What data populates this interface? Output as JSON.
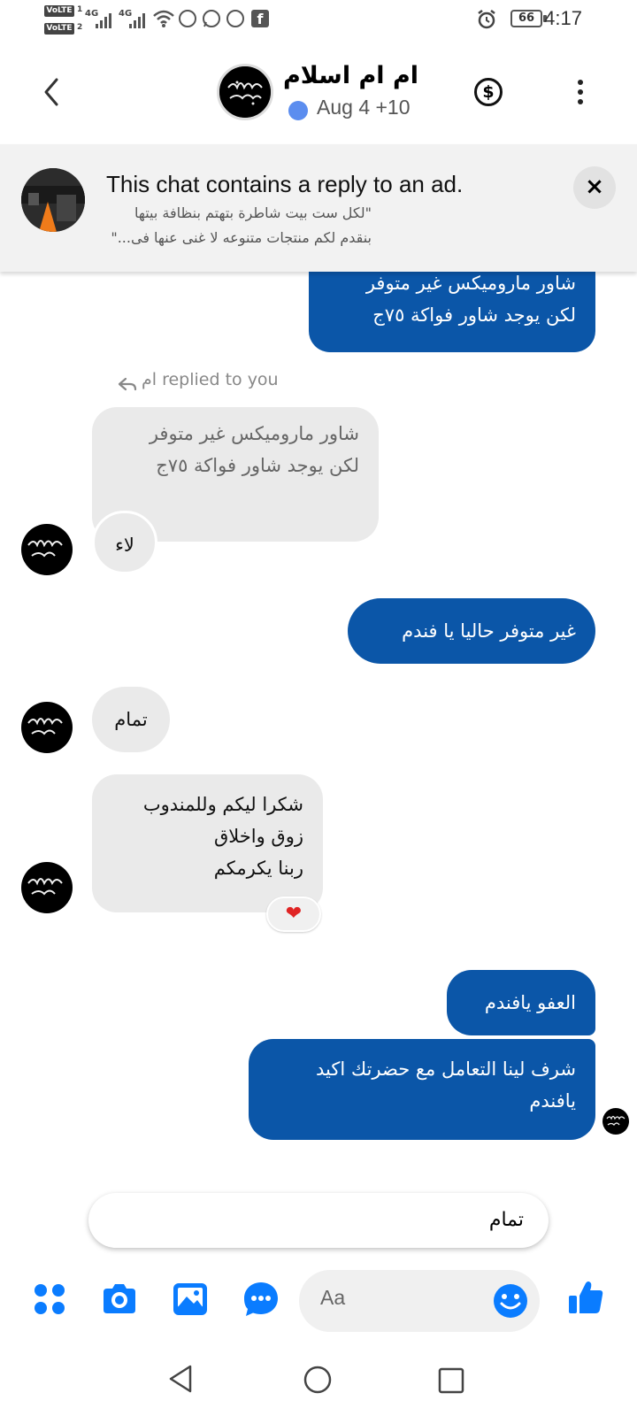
{
  "status_bar": {
    "volte1": "VoLTE",
    "sim1": "1",
    "volte2": "VoLTE",
    "sim2": "2",
    "net1": "4G",
    "net2": "4G",
    "battery": "66",
    "time": "4:17"
  },
  "header": {
    "name": "ام ام اسلام",
    "status": "Aug 4 +10",
    "status_dot_color": "#5b8def",
    "icons": [
      "back-arrow-icon",
      "dollar-icon",
      "more-vertical-icon"
    ]
  },
  "ad_banner": {
    "title": "This chat contains a reply to an ad.",
    "snippet_line1": "\"لكل ست بيت شاطرة بتهتم بنظافة بيتها",
    "snippet_line2": "بنقدم لكم منتجات متنوعه لا غنى عنها فى...\"",
    "close": "×"
  },
  "messages": {
    "m0_line1": "شاور ماروميكس غير متوفر",
    "m0_line2": "لكن يوجد شاور فواكة ٧٥ج",
    "reply_label": "ام replied to you",
    "quoted_line1": "شاور ماروميكس غير متوفر",
    "quoted_line2": "لكن يوجد شاور فواكة ٧٥ج",
    "m1": "لاء",
    "m2": "غير متوفر حاليا يا فندم",
    "m3": "تمام",
    "m4_line1": "شكرا ليكم وللمندوب",
    "m4_line2": "زوق واخلاق",
    "m4_line3": "ربنا يكرمكم",
    "m4_reaction": "❤",
    "m5": "العفو يافندم",
    "m6_line1": "شرف لينا التعامل مع حضرتك اكيد",
    "m6_line2": "يافندم"
  },
  "quick_reply": {
    "text": "تمام"
  },
  "composer": {
    "placeholder": "Aa",
    "icons": [
      "apps-icon",
      "camera-icon",
      "gallery-icon",
      "chat-bubble-icon",
      "emoji-icon",
      "like-icon"
    ]
  },
  "colors": {
    "outgoing_bubble": "#0b56a8",
    "incoming_bubble": "#eaeaea",
    "messenger_blue": "#0a7cff"
  }
}
